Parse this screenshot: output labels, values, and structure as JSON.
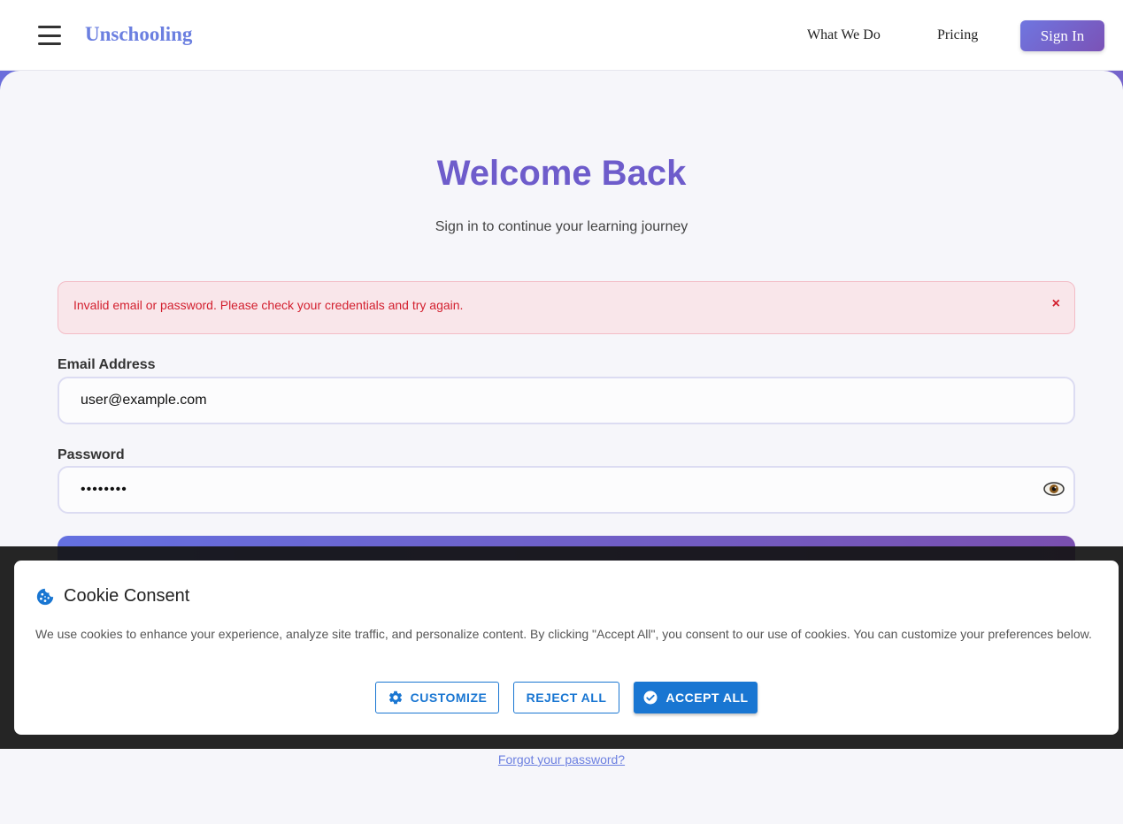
{
  "header": {
    "brand": "Unschooling",
    "nav": [
      {
        "label": "What We Do"
      },
      {
        "label": "Pricing"
      }
    ],
    "signin_label": "Sign In"
  },
  "login": {
    "title": "Welcome Back",
    "subtitle": "Sign in to continue your learning journey",
    "error": "Invalid email or password. Please check your credentials and try again.",
    "error_close": "×",
    "email_label": "Email Address",
    "email_value": "user@example.com",
    "password_label": "Password",
    "password_value": "password",
    "forgot_label": "Forgot your password?"
  },
  "cookie": {
    "title": "Cookie Consent",
    "text": "We use cookies to enhance your experience, analyze site traffic, and personalize content. By clicking \"Accept All\", you consent to our use of cookies. You can customize your preferences below.",
    "customize_label": "CUSTOMIZE",
    "reject_label": "REJECT ALL",
    "accept_label": "ACCEPT ALL"
  },
  "colors": {
    "brand": "#6b7fe0",
    "title": "#6e5ccb",
    "error": "#d3202f",
    "cookie_primary": "#1976d2"
  },
  "icons": [
    "menu-icon",
    "eye-icon",
    "cookie-icon",
    "gear-icon",
    "check-circle-icon"
  ]
}
